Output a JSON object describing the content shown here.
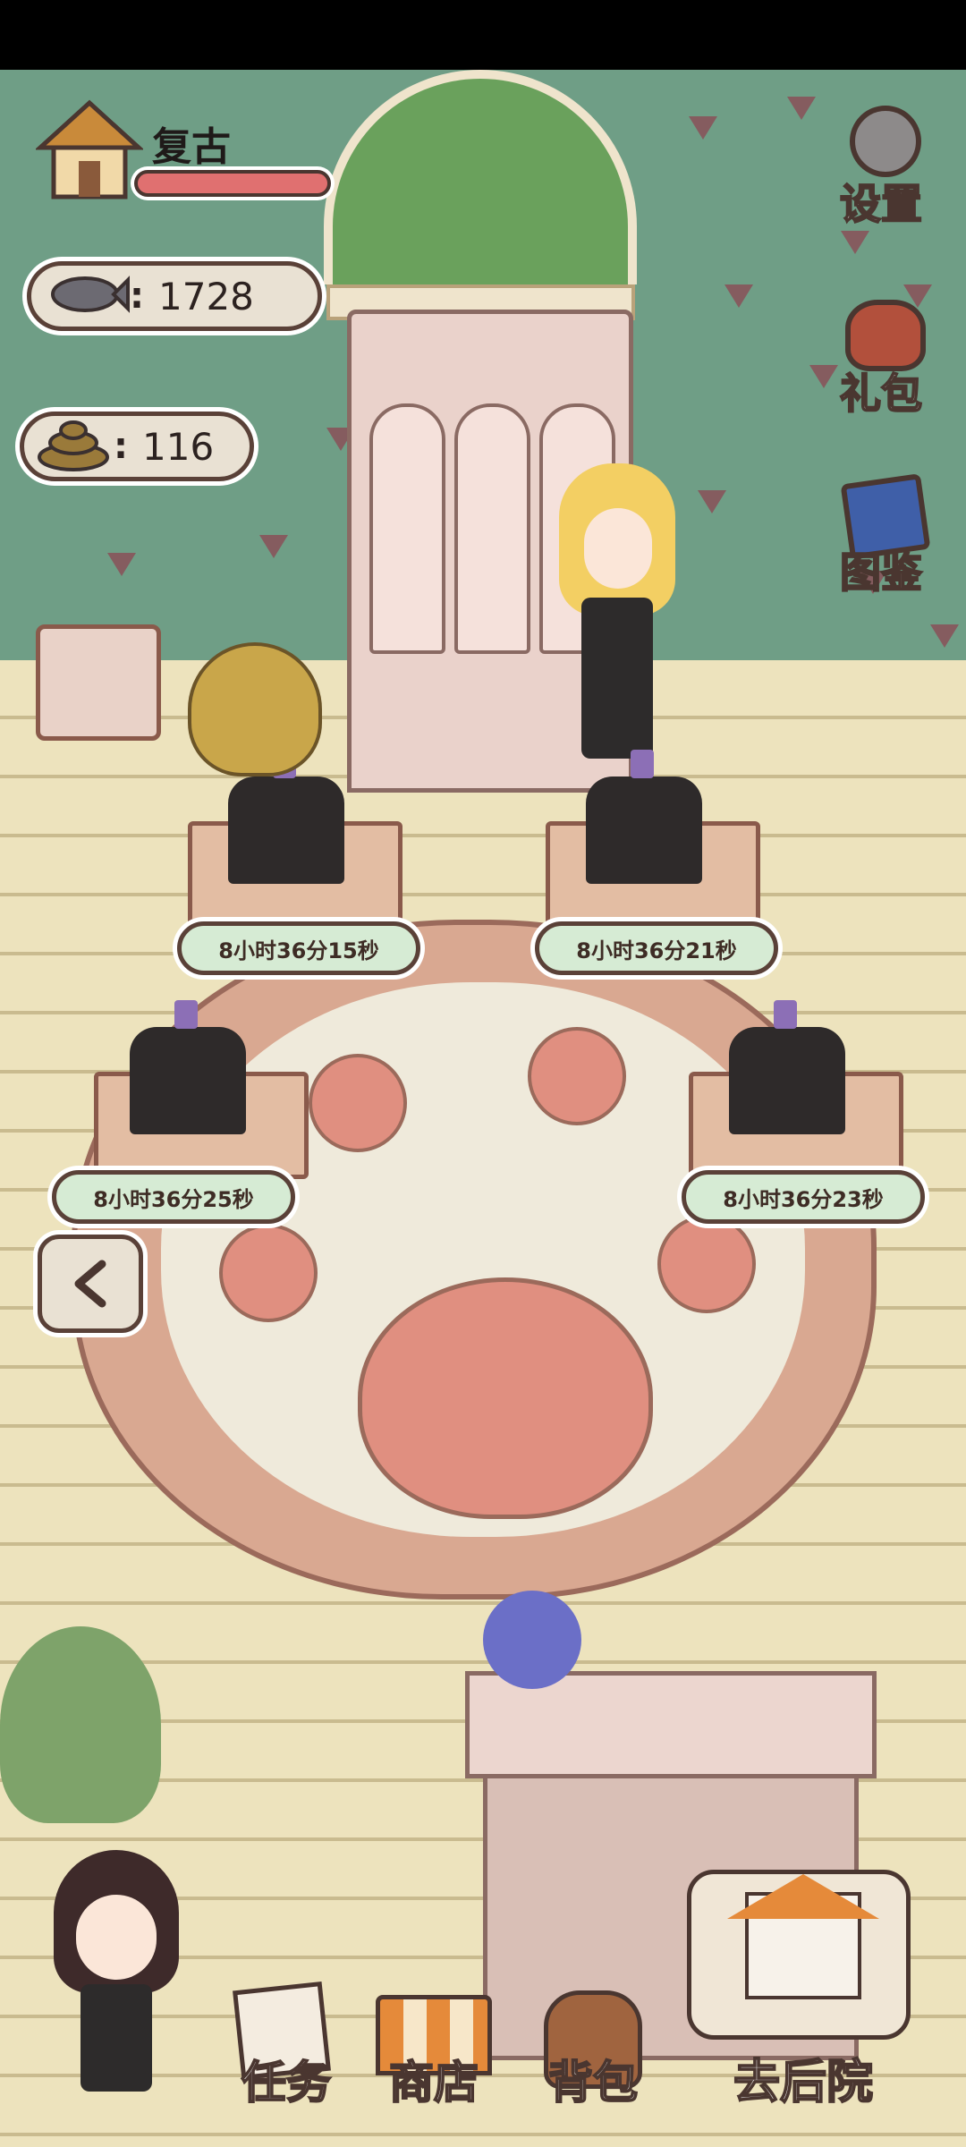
{
  "player": {
    "name": "复古",
    "hp_fraction": 1.0
  },
  "currencies": {
    "fish": "1728",
    "poop": "116"
  },
  "side_menu": {
    "settings": "设置",
    "gift": "礼包",
    "collection": "图鉴"
  },
  "timers": [
    "8小时36分15秒",
    "8小时36分21秒",
    "8小时36分25秒",
    "8小时36分23秒"
  ],
  "bottom_nav": {
    "tasks": "任务",
    "shop": "商店",
    "bag": "背包",
    "backyard": "去后院"
  },
  "colors": {
    "wall": "#6f9e86",
    "floor": "#ede3bd",
    "timer_bg": "#d6ebd4",
    "hp_bar": "#e07070"
  },
  "icons": [
    "house-icon",
    "fish-icon",
    "poop-icon",
    "gear-icon",
    "gift-bag-icon",
    "book-icon",
    "back-chevron-icon"
  ]
}
